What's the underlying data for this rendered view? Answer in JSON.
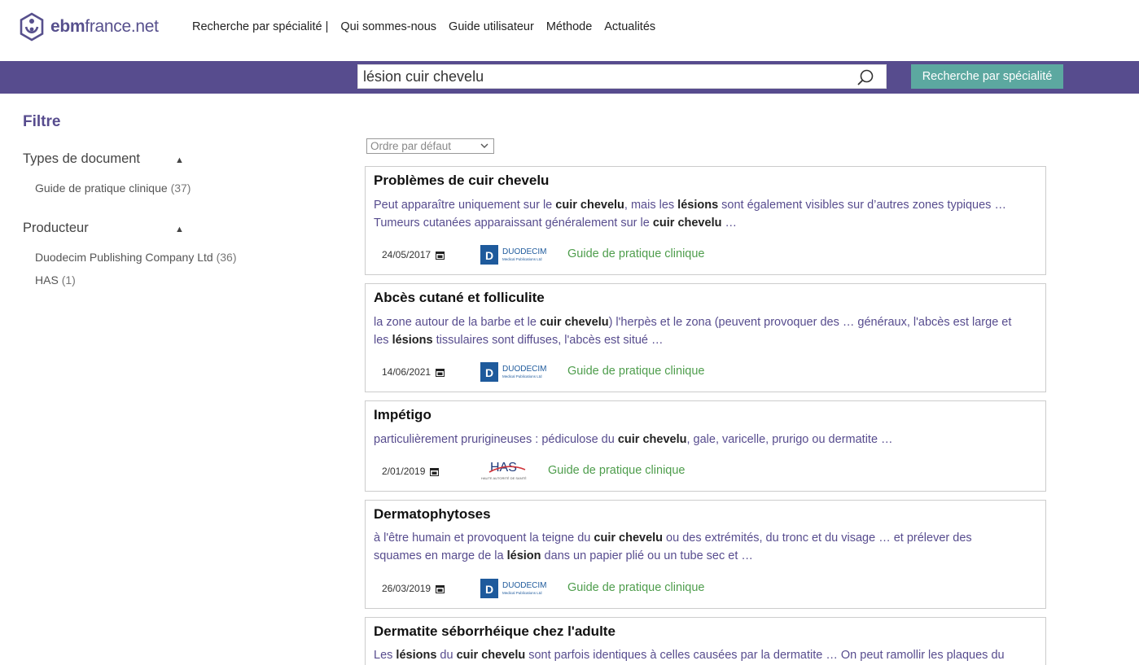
{
  "header": {
    "logo_text_bold": "ebm",
    "logo_text_rest": "france.net",
    "nav": [
      "Recherche par spécialité |",
      "Qui sommes-nous",
      "Guide utilisateur",
      "Méthode",
      "Actualités"
    ]
  },
  "search": {
    "value": "lésion cuir chevelu",
    "button_label": "Recherche par spécialité"
  },
  "sidebar": {
    "title": "Filtre",
    "facets": [
      {
        "title": "Types de document",
        "items": [
          {
            "label": "Guide de pratique clinique",
            "count": "(37)"
          }
        ]
      },
      {
        "title": "Producteur",
        "items": [
          {
            "label": "Duodecim Publishing Company Ltd",
            "count": "(36)"
          },
          {
            "label": "HAS",
            "count": "(1)"
          }
        ]
      }
    ]
  },
  "sort": {
    "selected": "Ordre par défaut"
  },
  "results": [
    {
      "title": "Problèmes de cuir chevelu",
      "snippet_lines": [
        [
          [
            "Peut apparaître uniquement sur le ",
            false
          ],
          [
            "cuir chevelu",
            true
          ],
          [
            ", mais les ",
            false
          ],
          [
            "lésions",
            true
          ],
          [
            " sont également visibles sur d’autres zones typiques …",
            false
          ]
        ],
        [
          [
            "Tumeurs cutanées apparaissant généralement sur le ",
            false
          ],
          [
            "cuir chevelu",
            true
          ],
          [
            " …",
            false
          ]
        ]
      ],
      "date": "24/05/2017",
      "producer": "DUODECIM",
      "producer_sub": "Medical Publications Ltd",
      "doc_type": "Guide de pratique clinique"
    },
    {
      "title": "Abcès cutané et folliculite",
      "snippet_lines": [
        [
          [
            "la zone autour de la barbe et le ",
            false
          ],
          [
            "cuir chevelu",
            true
          ],
          [
            ") l'herpès et le zona (peuvent provoquer des … généraux, l'abcès est large et",
            false
          ]
        ],
        [
          [
            "les ",
            false
          ],
          [
            "lésions",
            true
          ],
          [
            " tissulaires sont diffuses, l'abcès est situé …",
            false
          ]
        ]
      ],
      "date": "14/06/2021",
      "producer": "DUODECIM",
      "producer_sub": "Medical Publications Ltd",
      "doc_type": "Guide de pratique clinique"
    },
    {
      "title": "Impétigo",
      "snippet_lines": [
        [
          [
            "particulièrement prurigineuses : pédiculose du ",
            false
          ],
          [
            "cuir chevelu",
            true
          ],
          [
            ", gale, varicelle, prurigo ou dermatite …",
            false
          ]
        ]
      ],
      "date": "2/01/2019",
      "producer": "HAS",
      "producer_sub": "HAUTE AUTORITÉ DE SANTÉ",
      "doc_type": "Guide de pratique clinique"
    },
    {
      "title": "Dermatophytoses",
      "snippet_lines": [
        [
          [
            "à l'être humain et provoquent la teigne du ",
            false
          ],
          [
            "cuir chevelu",
            true
          ],
          [
            " ou des extrémités, du tronc et du visage … et prélever des",
            false
          ]
        ],
        [
          [
            "squames en marge de la ",
            false
          ],
          [
            "lésion",
            true
          ],
          [
            " dans un papier plié ou un tube sec et …",
            false
          ]
        ]
      ],
      "date": "26/03/2019",
      "producer": "DUODECIM",
      "producer_sub": "Medical Publications Ltd",
      "doc_type": "Guide de pratique clinique"
    },
    {
      "title": "Dermatite séborrhéique chez l'adulte",
      "snippet_lines": [
        [
          [
            "Les ",
            false
          ],
          [
            "lésions",
            true
          ],
          [
            " du ",
            false
          ],
          [
            "cuir chevelu",
            true
          ],
          [
            " sont parfois identiques à celles causées par la dermatite … On peut ramollir les plaques du",
            false
          ]
        ]
      ],
      "date": "",
      "producer": "",
      "producer_sub": "",
      "doc_type": ""
    }
  ],
  "colors": {
    "brand_purple": "#574c8e",
    "teal_button": "#5ca8a0",
    "doc_type_green": "#4e9d4c",
    "duodecim_blue": "#1e5a9c",
    "has_red": "#d0343a"
  }
}
